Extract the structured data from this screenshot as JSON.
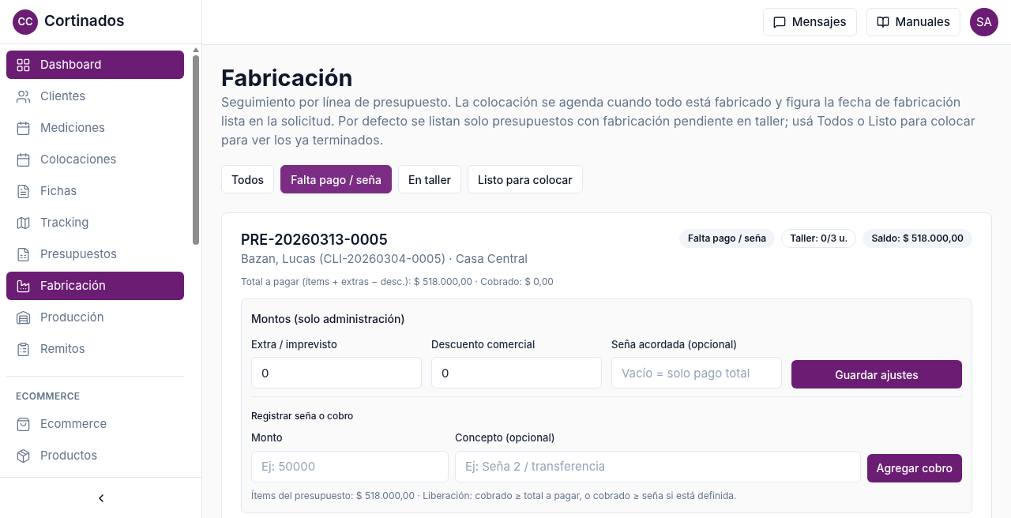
{
  "brand": {
    "initials": "CC",
    "name": "Cortinados"
  },
  "sidebar": {
    "items": [
      {
        "label": "Dashboard",
        "selected": true
      },
      {
        "label": "Clientes",
        "selected": false
      },
      {
        "label": "Mediciones",
        "selected": false
      },
      {
        "label": "Colocaciones",
        "selected": false
      },
      {
        "label": "Fichas",
        "selected": false
      },
      {
        "label": "Tracking",
        "selected": false
      },
      {
        "label": "Presupuestos",
        "selected": false
      },
      {
        "label": "Fabricación",
        "selected": true
      },
      {
        "label": "Producción",
        "selected": false
      },
      {
        "label": "Remitos",
        "selected": false
      }
    ],
    "section": {
      "title": "ECOMMERCE",
      "items": [
        {
          "label": "Ecommerce",
          "selected": false
        },
        {
          "label": "Productos",
          "selected": false
        }
      ]
    }
  },
  "header": {
    "buttons": [
      "Mensajes",
      "Manuales"
    ],
    "avatar": "SA"
  },
  "page": {
    "title": "Fabricación",
    "description": "Seguimiento por línea de presupuesto. La colocación se agenda cuando todo está fabricado y figura la fecha de fabricación lista en la solicitud. Por defecto se listan solo presupuestos con fabricación pendiente en taller; usá Todos o Listo para colocar para ver los ya terminados."
  },
  "filters": [
    {
      "label": "Todos",
      "selected": false
    },
    {
      "label": "Falta pago / seña",
      "selected": true
    },
    {
      "label": "En taller",
      "selected": false
    },
    {
      "label": "Listo para colocar",
      "selected": false
    }
  ],
  "card": {
    "code": "PRE-20260313-0005",
    "client": "Bazan, Lucas (CLI-20260304-0005) · Casa Central",
    "totals": "Total a pagar (ítems + extras − desc.): $ 518.000,00 · Cobrado: $ 0,00",
    "badges": [
      {
        "label": "Falta pago / seña",
        "kind": "filled"
      },
      {
        "label": "Taller: 0/3 u.",
        "kind": "outline"
      },
      {
        "label": "Saldo: $ 518.000,00",
        "kind": "filled"
      }
    ],
    "amounts": {
      "title": "Montos (solo administración)",
      "fields": [
        {
          "label": "Extra / imprevisto",
          "value": "0"
        },
        {
          "label": "Descuento comercial",
          "value": "0"
        },
        {
          "label": "Seña acordada (opcional)",
          "placeholder": "Vacío = solo pago total"
        }
      ],
      "button": "Guardar ajustes",
      "payment_title": "Registrar seña o cobro",
      "payment_fields": [
        {
          "label": "Monto",
          "placeholder": "Ej: 50000"
        },
        {
          "label": "Concepto (opcional)",
          "placeholder": "Ej: Seña 2 / transferencia"
        }
      ],
      "payment_button": "Agregar cobro",
      "note": "Ítems del presupuesto: $ 518.000,00 · Liberación: cobrado ≥ total a pagar, o cobrado ≥ seña si está definida."
    }
  }
}
